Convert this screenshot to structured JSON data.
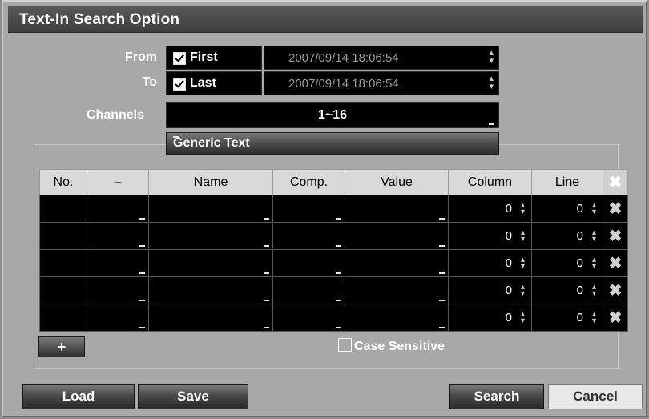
{
  "dialog": {
    "title": "Text-In Search Option"
  },
  "from": {
    "label": "From",
    "checkbox_label": "First",
    "checked": true,
    "datetime": "2007/09/14  18:06:54"
  },
  "to": {
    "label": "To",
    "checkbox_label": "Last",
    "checked": true,
    "datetime": "2007/09/14  18:06:54"
  },
  "channels": {
    "label": "Channels",
    "value": "1~16"
  },
  "text_type": {
    "value": "Generic Text"
  },
  "table": {
    "headers": [
      "No.",
      "–",
      "Name",
      "Comp.",
      "Value",
      "Column",
      "Line",
      "✖"
    ],
    "rows": [
      {
        "no": "",
        "op": "",
        "name": "",
        "comp": "",
        "value": "",
        "column": "0",
        "line": "0"
      },
      {
        "no": "",
        "op": "",
        "name": "",
        "comp": "",
        "value": "",
        "column": "0",
        "line": "0"
      },
      {
        "no": "",
        "op": "",
        "name": "",
        "comp": "",
        "value": "",
        "column": "0",
        "line": "0"
      },
      {
        "no": "",
        "op": "",
        "name": "",
        "comp": "",
        "value": "",
        "column": "0",
        "line": "0"
      },
      {
        "no": "",
        "op": "",
        "name": "",
        "comp": "",
        "value": "",
        "column": "0",
        "line": "0"
      }
    ]
  },
  "add_button": {
    "label": "+"
  },
  "case_sensitive": {
    "label": "Case Sensitive",
    "checked": false
  },
  "buttons": {
    "load": "Load",
    "save": "Save",
    "search": "Search",
    "cancel": "Cancel"
  },
  "colors": {
    "background": "#a8a8a8",
    "field": "#000000",
    "title_bar": "#4a4a4a",
    "header_cell": "#d9d9d9"
  },
  "icons": {
    "delete": "close-x-icon",
    "spinner": "spinner-updown-icon",
    "dropdown": "dropdown-marker-icon"
  }
}
